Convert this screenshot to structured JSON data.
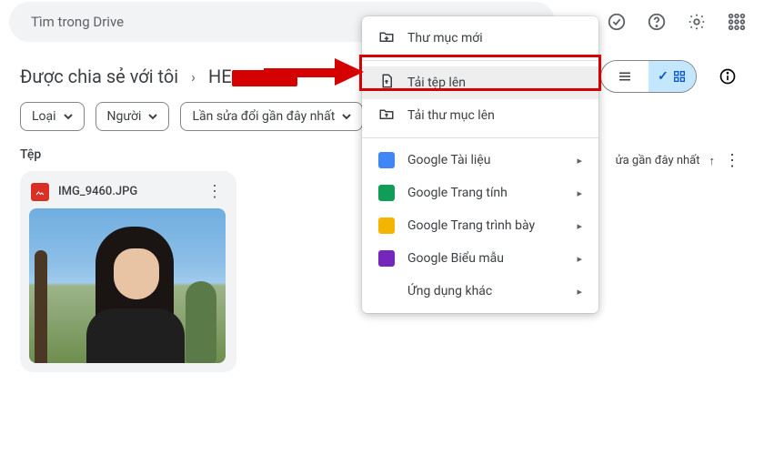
{
  "search": {
    "placeholder": "Tìm trong Drive"
  },
  "breadcrumb": {
    "root": "Được chia sẻ với tôi",
    "folder_prefix": "HE"
  },
  "view_toggle": {
    "list_check": "✓"
  },
  "filters": {
    "type": "Loại",
    "people": "Người",
    "modified": "Lần sửa đổi gần đây nhất"
  },
  "section_label": "Tệp",
  "sort": {
    "label": "ửa gần đây nhất"
  },
  "file": {
    "name": "IMG_9460.JPG"
  },
  "menu": {
    "new_folder": "Thư mục mới",
    "upload_file": "Tải tệp lên",
    "upload_folder": "Tải thư mục lên",
    "docs": "Google Tài liệu",
    "sheets": "Google Trang tính",
    "slides": "Google Trang trình bày",
    "forms": "Google Biểu mẫu",
    "more": "Ứng dụng khác"
  }
}
